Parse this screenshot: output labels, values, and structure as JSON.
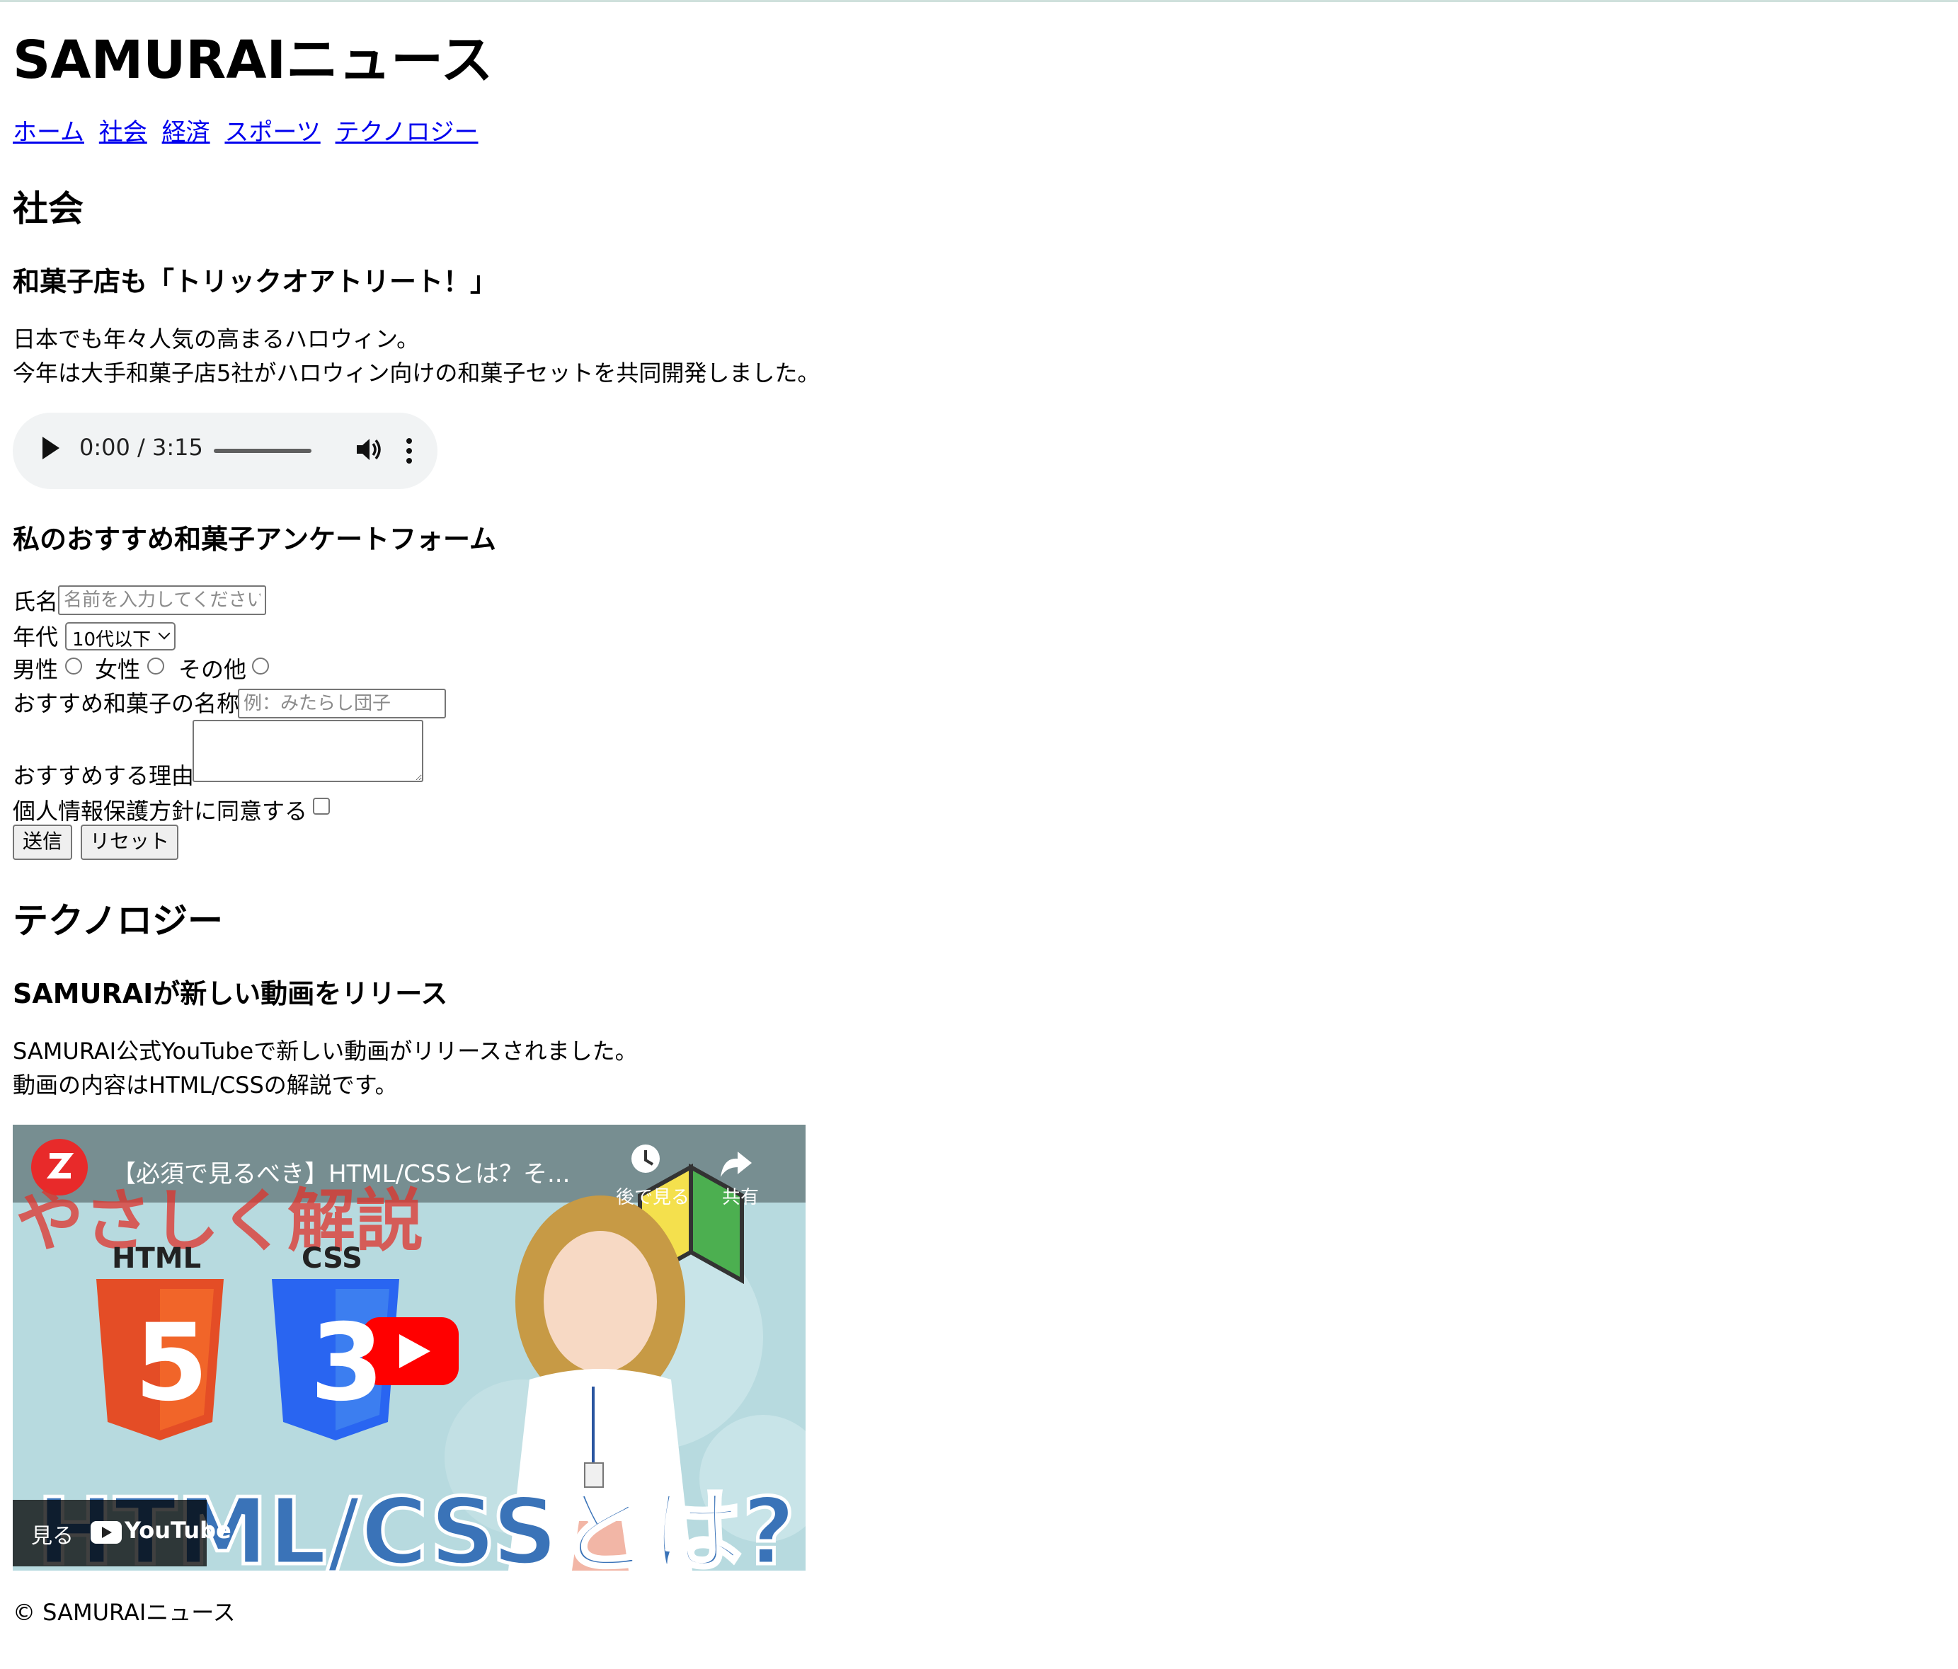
{
  "header": {
    "site_title": "SAMURAIニュース",
    "nav": [
      "ホーム",
      "社会",
      "経済",
      "スポーツ",
      "テクノロジー"
    ]
  },
  "society": {
    "heading": "社会",
    "article_title": "和菓子店も「トリックオアトリート！」",
    "body": [
      "日本でも年々人気の高まるハロウィン。",
      "今年は大手和菓子店5社がハロウィン向けの和菓子セットを共同開発しました。"
    ],
    "audio": {
      "time": "0:00 / 3:15"
    }
  },
  "form": {
    "title": "私のおすすめ和菓子アンケートフォーム",
    "name_label": "氏名",
    "name_placeholder": "名前を入力してください",
    "age_label": "年代",
    "age_selected": "10代以下",
    "gender_options": [
      "男性",
      "女性",
      "その他"
    ],
    "sweet_label": "おすすめ和菓子の名称",
    "sweet_placeholder": "例：みたらし団子",
    "reason_label": "おすすめする理由",
    "agree_label": "個人情報保護方針に同意する",
    "submit": "送信",
    "reset": "リセット"
  },
  "technology": {
    "heading": "テクノロジー",
    "article_title": "SAMURAIが新しい動画をリリース",
    "body": [
      "SAMURAI公式YouTubeで新しい動画がリリースされました。",
      "動画の内容はHTML/CSSの解説です。"
    ],
    "video": {
      "title": "【必須で見るべき】HTML/CSSとは？そ...",
      "watch_later": "後で見る",
      "share": "共有",
      "banner": "やさしく解説",
      "html_label": "HTML",
      "css_label": "CSS",
      "html_num": "5",
      "css_num": "3",
      "big_text": "HTML/CSSとは?",
      "watch_on": "見る",
      "youtube": "YouTube"
    }
  },
  "footer": {
    "text": "© SAMURAIニュース"
  },
  "colors": {
    "link": "#0000ee",
    "audio_bg": "#f1f3f4",
    "youtube_red": "#ff0000",
    "html_orange": "#e44d26",
    "css_blue": "#2965f1"
  }
}
